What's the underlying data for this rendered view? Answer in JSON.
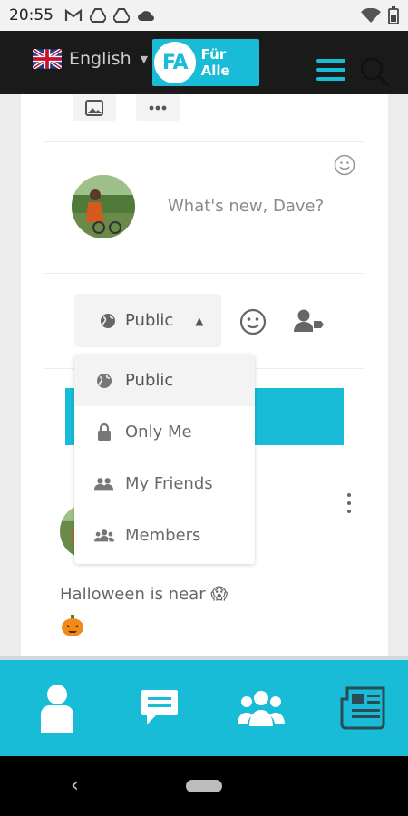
{
  "status_bar": {
    "time": "20:55",
    "left_icons": [
      "gmail-icon",
      "drive-icon",
      "drive-icon",
      "cloud-icon"
    ],
    "right_icons": [
      "wifi-icon",
      "battery-icon"
    ]
  },
  "header": {
    "language": "English",
    "flag": "uk-flag-icon",
    "logo_mark": "FA",
    "logo_text": "Für Alle",
    "menu_icon": "hamburger-icon",
    "search_icon": "search-icon"
  },
  "composer": {
    "placeholder": "What's new, Dave?",
    "privacy_label": "Public",
    "toolbar_icons": [
      "image-icon",
      "more-icon",
      "emoji-icon",
      "tag-user-icon"
    ]
  },
  "privacy_menu": {
    "items": [
      {
        "label": "Public",
        "icon": "globe-icon",
        "selected": true
      },
      {
        "label": "Only Me",
        "icon": "lock-icon",
        "selected": false
      },
      {
        "label": "My Friends",
        "icon": "friends-icon",
        "selected": false
      },
      {
        "label": "Members",
        "icon": "members-icon",
        "selected": false
      }
    ]
  },
  "feed": {
    "post_text": "Halloween is near 😱",
    "post_emoji": "🎃"
  },
  "bottom_nav": {
    "tabs": [
      "profile-icon",
      "messages-icon",
      "groups-icon",
      "news-icon"
    ]
  },
  "colors": {
    "accent": "#18bcd6",
    "header_bg": "#1a1a1a",
    "card_bg": "#ffffff",
    "page_bg": "#ececec"
  }
}
